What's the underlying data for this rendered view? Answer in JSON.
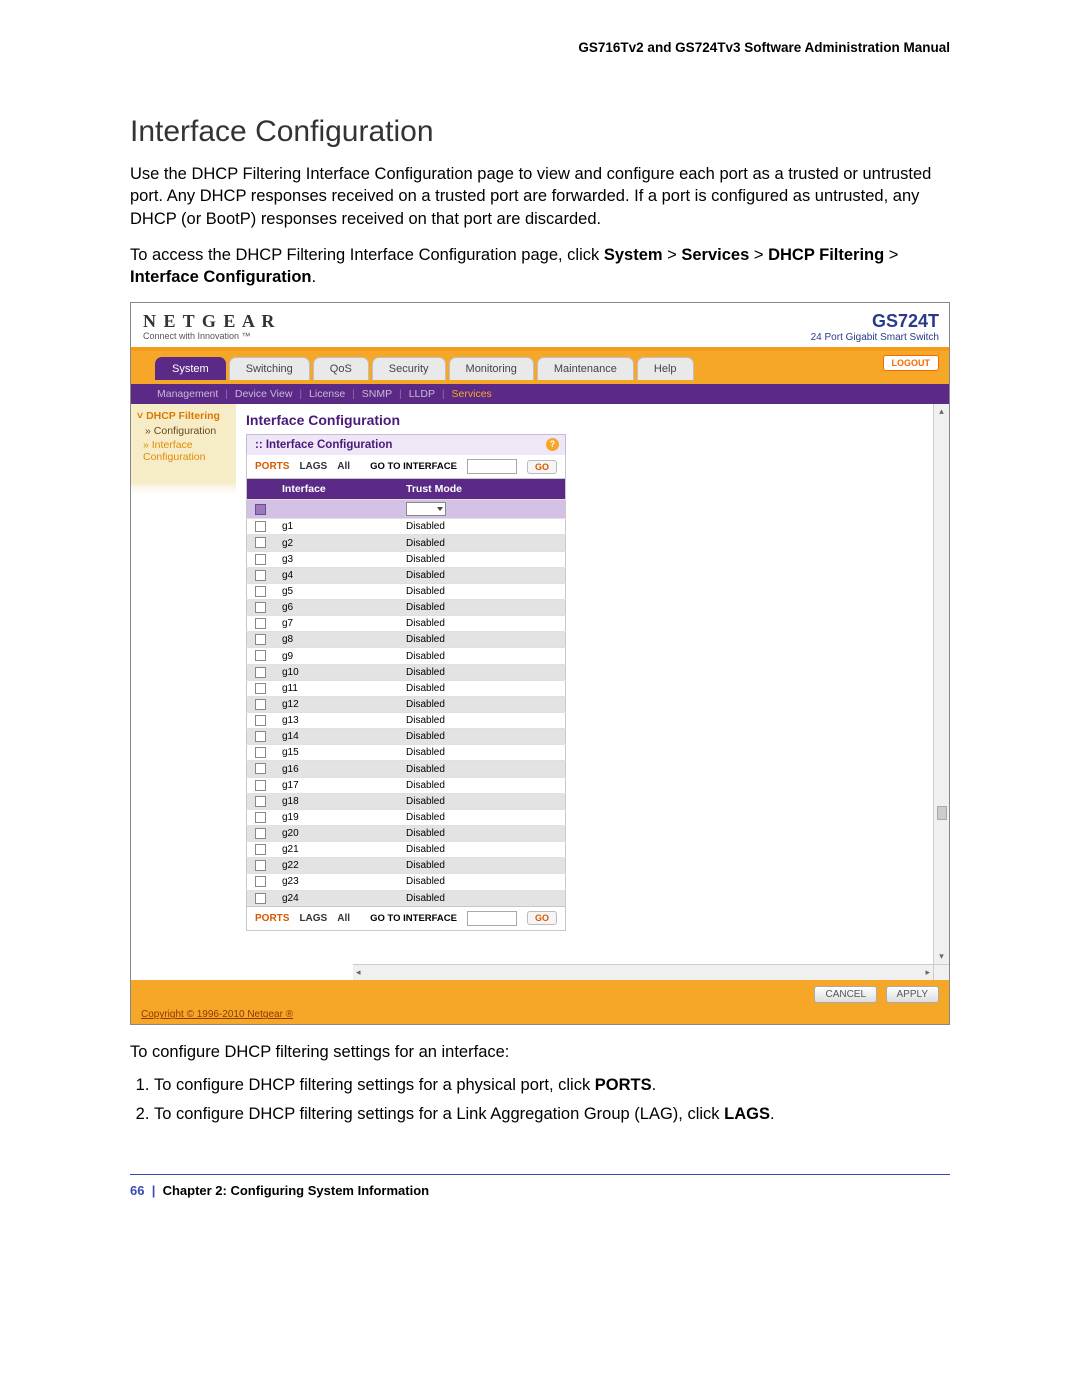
{
  "doc": {
    "header": "GS716Tv2 and GS724Tv3 Software Administration Manual",
    "title": "Interface Configuration",
    "p1": "Use the DHCP Filtering Interface Configuration page to view and configure each port as a trusted or untrusted port. Any DHCP responses received on a trusted port are forwarded. If a port is configured as untrusted, any DHCP (or BootP) responses received on that port are discarded.",
    "p2a": "To access the DHCP Filtering Interface Configuration page, click ",
    "p2b": "System",
    "p2c": "Services",
    "p2d": "DHCP Filtering",
    "p2e": "Interface Configuration",
    "after": "To configure DHCP filtering settings for an interface:",
    "li1a": "To configure DHCP filtering settings for a physical port, click ",
    "li1b": "PORTS",
    "li2a": "To configure DHCP filtering settings for a Link Aggregation Group (LAG), click ",
    "li2b": "LAGS",
    "footer_page": "66",
    "footer_chapter": "Chapter 2:  Configuring System Information"
  },
  "app": {
    "brand": "N E T G E A R",
    "tagline": "Connect with Innovation ™",
    "model": "GS724T",
    "model_sub": "24 Port Gigabit Smart Switch",
    "logout": "LOGOUT",
    "tabs": [
      "System",
      "Switching",
      "QoS",
      "Security",
      "Monitoring",
      "Maintenance",
      "Help"
    ],
    "subnav": [
      "Management",
      "Device View",
      "License",
      "SNMP",
      "LLDP",
      "Services"
    ],
    "subnav_active": "Services",
    "sidebar": {
      "top": "DHCP Filtering",
      "items": [
        "Configuration",
        "Interface Configuration"
      ],
      "active": "Interface Configuration"
    },
    "panel": {
      "title": "Interface Configuration",
      "sub": "Interface Configuration",
      "filter": {
        "ports": "PORTS",
        "lags": "LAGS",
        "all": "All",
        "goto": "GO TO INTERFACE",
        "go": "GO"
      },
      "headers": [
        "Interface",
        "Trust Mode"
      ],
      "rows": [
        {
          "if": "g1",
          "mode": "Disabled"
        },
        {
          "if": "g2",
          "mode": "Disabled"
        },
        {
          "if": "g3",
          "mode": "Disabled"
        },
        {
          "if": "g4",
          "mode": "Disabled"
        },
        {
          "if": "g5",
          "mode": "Disabled"
        },
        {
          "if": "g6",
          "mode": "Disabled"
        },
        {
          "if": "g7",
          "mode": "Disabled"
        },
        {
          "if": "g8",
          "mode": "Disabled"
        },
        {
          "if": "g9",
          "mode": "Disabled"
        },
        {
          "if": "g10",
          "mode": "Disabled"
        },
        {
          "if": "g11",
          "mode": "Disabled"
        },
        {
          "if": "g12",
          "mode": "Disabled"
        },
        {
          "if": "g13",
          "mode": "Disabled"
        },
        {
          "if": "g14",
          "mode": "Disabled"
        },
        {
          "if": "g15",
          "mode": "Disabled"
        },
        {
          "if": "g16",
          "mode": "Disabled"
        },
        {
          "if": "g17",
          "mode": "Disabled"
        },
        {
          "if": "g18",
          "mode": "Disabled"
        },
        {
          "if": "g19",
          "mode": "Disabled"
        },
        {
          "if": "g20",
          "mode": "Disabled"
        },
        {
          "if": "g21",
          "mode": "Disabled"
        },
        {
          "if": "g22",
          "mode": "Disabled"
        },
        {
          "if": "g23",
          "mode": "Disabled"
        },
        {
          "if": "g24",
          "mode": "Disabled"
        }
      ]
    },
    "buttons": {
      "cancel": "CANCEL",
      "apply": "APPLY"
    },
    "copyright": "Copyright © 1996-2010 Netgear ®"
  }
}
